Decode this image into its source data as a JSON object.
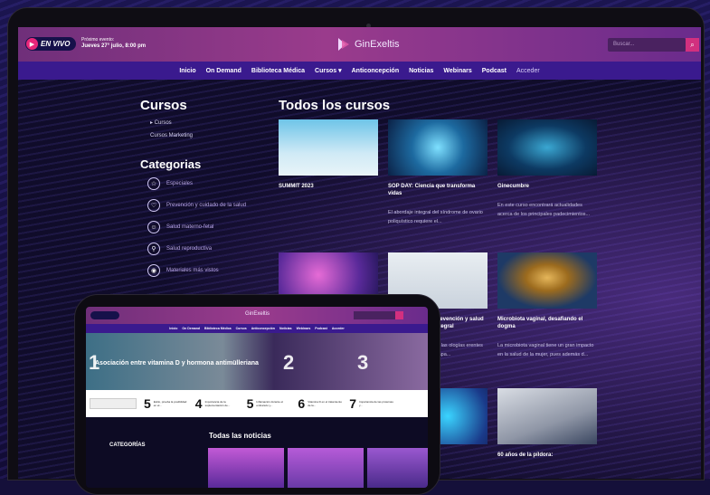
{
  "header": {
    "live_label": "EN VIVO",
    "next_event_label": "Próximo evento:",
    "next_event_date": "Jueves 27° julio, 8:00 pm",
    "brand": "GinExeltis",
    "search_placeholder": "Buscar...",
    "search_icon": "magnifier-icon"
  },
  "nav": {
    "items": [
      "Inicio",
      "On Demand",
      "Biblioteca Médica",
      "Cursos ▾",
      "Anticoncepción",
      "Noticias",
      "Webinars",
      "Podcast",
      "Acceder"
    ]
  },
  "sidebar": {
    "title": "Cursos",
    "links": [
      "▸ Cursos",
      "Cursos Marketing"
    ],
    "categories_title": "Categorias",
    "categories": [
      {
        "label": "Especiales",
        "icon": "star-icon"
      },
      {
        "label": "Prevención y cuidado de la salud",
        "icon": "shield-heart-icon"
      },
      {
        "label": "Salud materno-fetal",
        "icon": "baby-icon"
      },
      {
        "label": "Salud reproductiva",
        "icon": "uterus-icon"
      },
      {
        "label": "Materiales más vistos",
        "icon": "eye-icon"
      }
    ]
  },
  "main": {
    "title": "Todos los cursos",
    "courses": [
      {
        "title": "SUMMIT 2023",
        "desc": ""
      },
      {
        "title": "SOP DAY: Ciencia que transforma vidas",
        "desc": "El abordaje integral del síndrome de ovario poliquístico requiere el..."
      },
      {
        "title": "Ginecumbre",
        "desc": "En este curso encontrará actualidades acerca de los principales padecimientos..."
      },
      {
        "title": "",
        "desc": ""
      },
      {
        "title": "Prevención y salud integral",
        "desc": "de las ologías erentes etapa..."
      },
      {
        "title": "Microbiota vaginal, desafiando el dogma",
        "desc": "La microbiota vaginal tiene un gran impacto en la salud de la mujer, pues además d..."
      },
      {
        "title": "",
        "desc": ""
      },
      {
        "title": "",
        "desc": ""
      },
      {
        "title": "60 años de la píldora:",
        "desc": ""
      }
    ]
  },
  "tablet": {
    "brand": "GinExeltis",
    "nav": [
      "Inicio",
      "On Demand",
      "Biblioteca Médica",
      "Cursos",
      "Anticoncepción",
      "Noticias",
      "Webinars",
      "Podcast",
      "Acceder"
    ],
    "hero_title": "Asociación entre vitamina D y hormona antimülleriana",
    "hero_numbers": [
      "1",
      "2",
      "3"
    ],
    "ticker": [
      {
        "n": "5",
        "t": "Estilo, prueba la posibilidad en el..."
      },
      {
        "n": "4",
        "t": "Importancia de la suplementación de..."
      },
      {
        "n": "5",
        "t": "Inflamación durante el embarazo y..."
      },
      {
        "n": "6",
        "t": "Vitamina D en el tratamiento de la..."
      },
      {
        "n": "7",
        "t": "Importancia de las proteínas y..."
      }
    ],
    "categories_title": "CATEGORÍAS",
    "news_title": "Todas las noticias"
  },
  "colors": {
    "accent_pink": "#d2307f",
    "nav_purple": "#3a1a8e",
    "header_magenta": "#9a3b8c"
  }
}
